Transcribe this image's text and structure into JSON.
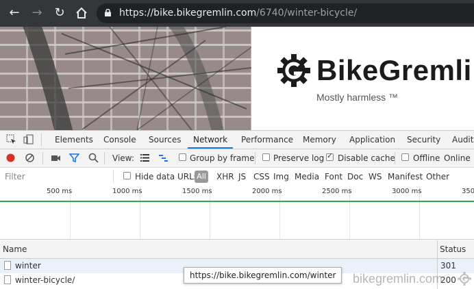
{
  "browser": {
    "url_host": "https://bike.bikegremlin.com",
    "url_path": "/6740/winter-bicycle/"
  },
  "site": {
    "logo_text": "BikeGremli",
    "tagline": "Mostly harmless ™"
  },
  "devtools": {
    "tabs": [
      "Elements",
      "Console",
      "Sources",
      "Network",
      "Performance",
      "Memory",
      "Application",
      "Security",
      "Audits"
    ],
    "active_tab": "Network",
    "toolbar": {
      "view_label": "View:",
      "group_by_frame": "Group by frame",
      "preserve_log": "Preserve log",
      "disable_cache": "Disable cache",
      "offline": "Offline",
      "online": "Online"
    },
    "filter": {
      "placeholder": "Filter",
      "hide_data_urls": "Hide data URLs",
      "types": [
        "All",
        "XHR",
        "JS",
        "CSS",
        "Img",
        "Media",
        "Font",
        "Doc",
        "WS",
        "Manifest",
        "Other"
      ]
    },
    "timeline_ticks": [
      "500 ms",
      "1000 ms",
      "1500 ms",
      "2000 ms",
      "2500 ms",
      "3000 ms",
      "350"
    ],
    "columns": {
      "name": "Name",
      "status": "Status"
    },
    "requests": [
      {
        "name": "winter",
        "status": "301"
      },
      {
        "name": "winter-bicycle/",
        "status": "200"
      }
    ],
    "tooltip": "https://bike.bikegremlin.com/winter"
  },
  "watermark": "bikegremlin.com",
  "colors": {
    "browser_bar": "#35363a",
    "active_tab_underline": "#1a73e8",
    "record_red": "#d93025",
    "filter_blue": "#1a73e8",
    "timeline_green": "#2ba84a"
  }
}
